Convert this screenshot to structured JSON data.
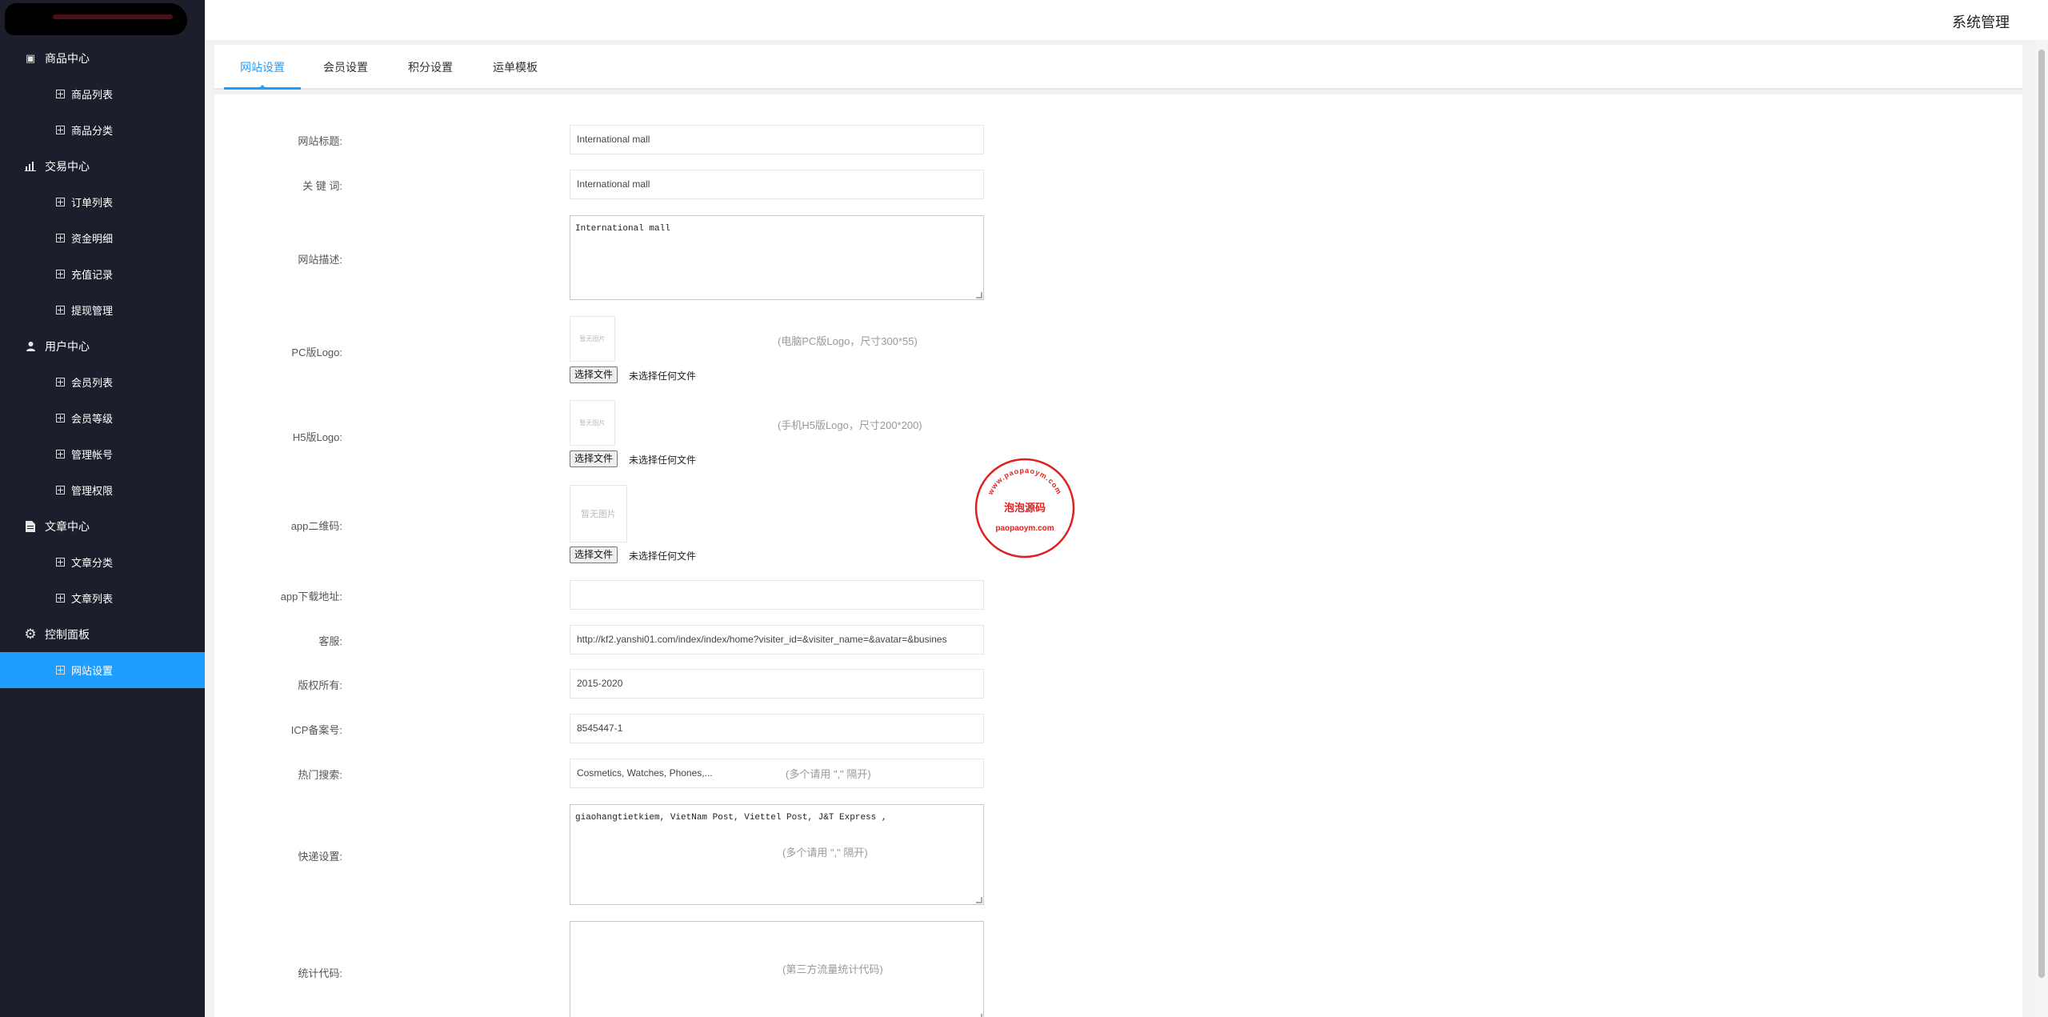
{
  "header": {
    "title": "系统管理"
  },
  "sidebar": {
    "groups": [
      {
        "label": "商品中心",
        "icon": "box-icon",
        "items": [
          "商品列表",
          "商品分类"
        ]
      },
      {
        "label": "交易中心",
        "icon": "bar-chart-icon",
        "items": [
          "订单列表",
          "资金明细",
          "充值记录",
          "提现管理"
        ]
      },
      {
        "label": "用户中心",
        "icon": "user-icon",
        "items": [
          "会员列表",
          "会员等级",
          "管理帐号",
          "管理权限"
        ]
      },
      {
        "label": "文章中心",
        "icon": "document-icon",
        "items": [
          "文章分类",
          "文章列表"
        ]
      },
      {
        "label": "控制面板",
        "icon": "gear-icon",
        "items": [
          "网站设置"
        ]
      }
    ],
    "active_item": "网站设置"
  },
  "tabs": [
    "网站设置",
    "会员设置",
    "积分设置",
    "运单模板"
  ],
  "form": {
    "site_title": {
      "label": "网站标题:",
      "value": "International mall"
    },
    "keywords": {
      "label": "关 键 词:",
      "value": "International mall"
    },
    "description": {
      "label": "网站描述:",
      "value": "International mall"
    },
    "pc_logo": {
      "label": "PC版Logo:",
      "placeholder": "暂无图片",
      "button": "选择文件",
      "status": "未选择任何文件",
      "hint": "(电脑PC版Logo，尺寸300*55)"
    },
    "h5_logo": {
      "label": "H5版Logo:",
      "placeholder": "暂无图片",
      "button": "选择文件",
      "status": "未选择任何文件",
      "hint": "(手机H5版Logo，尺寸200*200)"
    },
    "app_qr": {
      "label": "app二维码:",
      "placeholder": "暂无图片",
      "button": "选择文件",
      "status": "未选择任何文件"
    },
    "app_download": {
      "label": "app下载地址:",
      "value": ""
    },
    "customer_service": {
      "label": "客服:",
      "value": "http://kf2.yanshi01.com/index/index/home?visiter_id=&visiter_name=&avatar=&busines"
    },
    "copyright": {
      "label": "版权所有:",
      "value": "2015-2020"
    },
    "icp": {
      "label": "ICP备案号:",
      "value": "8545447-1"
    },
    "hot_search": {
      "label": "热门搜索:",
      "value": "Cosmetics, Watches, Phones,...",
      "hint": "(多个请用 \",\" 隔开)"
    },
    "express": {
      "label": "快递设置:",
      "value": "giaohangtietkiem, VietNam Post, Viettel Post, J&T Express ,",
      "hint": "(多个请用 \",\" 隔开)"
    },
    "stats_code": {
      "label": "统计代码:",
      "value": "",
      "hint": "(第三方流量统计代码)"
    }
  },
  "watermark": {
    "top": "www.paopaoym.com",
    "center": "泡泡源码",
    "bottom": "paopaoym.com"
  },
  "colors": {
    "sidebar_bg": "#1c1f2b",
    "accent": "#1e9fff",
    "stamp": "#e02020"
  }
}
